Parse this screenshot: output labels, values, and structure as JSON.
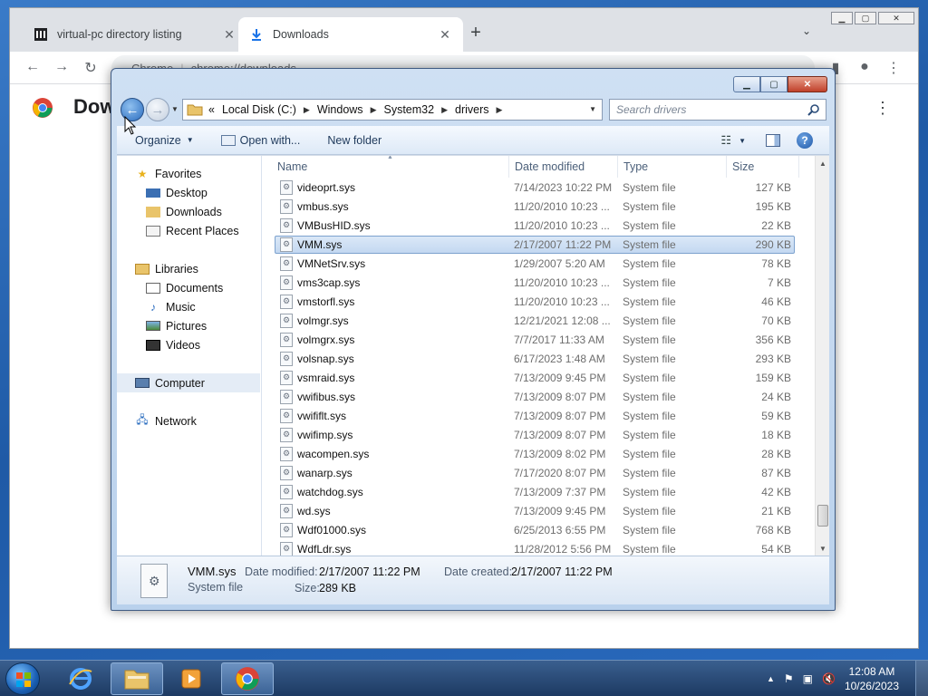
{
  "chrome": {
    "tabs": [
      {
        "title": "virtual-pc directory listing",
        "close": "✕"
      },
      {
        "title": "Downloads",
        "close": "✕"
      }
    ],
    "new_tab": "+",
    "tab_search": "⌄",
    "omnibox": {
      "site_label": "Chrome",
      "url": "chrome://downloads"
    },
    "page_title": "Dow",
    "menu_glyph": "⋮"
  },
  "explorer": {
    "caption": {
      "minimize": "▁",
      "maximize": "▢",
      "close": "✕"
    },
    "breadcrumb": {
      "prefix": "«",
      "items": [
        "Local Disk (C:)",
        "Windows",
        "System32",
        "drivers"
      ]
    },
    "search_placeholder": "Search drivers",
    "commands": {
      "organize": "Organize",
      "open_with": "Open with...",
      "new_folder": "New folder"
    },
    "nav": {
      "favorites": "Favorites",
      "favorites_items": [
        "Desktop",
        "Downloads",
        "Recent Places"
      ],
      "libraries": "Libraries",
      "libraries_items": [
        "Documents",
        "Music",
        "Pictures",
        "Videos"
      ],
      "computer": "Computer",
      "network": "Network"
    },
    "columns": {
      "name": "Name",
      "date": "Date modified",
      "type": "Type",
      "size": "Size"
    },
    "files": [
      {
        "name": "videoprt.sys",
        "date": "7/14/2023 10:22 PM",
        "type": "System file",
        "size": "127 KB"
      },
      {
        "name": "vmbus.sys",
        "date": "11/20/2010 10:23 ...",
        "type": "System file",
        "size": "195 KB"
      },
      {
        "name": "VMBusHID.sys",
        "date": "11/20/2010 10:23 ...",
        "type": "System file",
        "size": "22 KB"
      },
      {
        "name": "VMM.sys",
        "date": "2/17/2007 11:22 PM",
        "type": "System file",
        "size": "290 KB"
      },
      {
        "name": "VMNetSrv.sys",
        "date": "1/29/2007 5:20 AM",
        "type": "System file",
        "size": "78 KB"
      },
      {
        "name": "vms3cap.sys",
        "date": "11/20/2010 10:23 ...",
        "type": "System file",
        "size": "7 KB"
      },
      {
        "name": "vmstorfl.sys",
        "date": "11/20/2010 10:23 ...",
        "type": "System file",
        "size": "46 KB"
      },
      {
        "name": "volmgr.sys",
        "date": "12/21/2021 12:08 ...",
        "type": "System file",
        "size": "70 KB"
      },
      {
        "name": "volmgrx.sys",
        "date": "7/7/2017 11:33 AM",
        "type": "System file",
        "size": "356 KB"
      },
      {
        "name": "volsnap.sys",
        "date": "6/17/2023 1:48 AM",
        "type": "System file",
        "size": "293 KB"
      },
      {
        "name": "vsmraid.sys",
        "date": "7/13/2009 9:45 PM",
        "type": "System file",
        "size": "159 KB"
      },
      {
        "name": "vwifibus.sys",
        "date": "7/13/2009 8:07 PM",
        "type": "System file",
        "size": "24 KB"
      },
      {
        "name": "vwififlt.sys",
        "date": "7/13/2009 8:07 PM",
        "type": "System file",
        "size": "59 KB"
      },
      {
        "name": "vwifimp.sys",
        "date": "7/13/2009 8:07 PM",
        "type": "System file",
        "size": "18 KB"
      },
      {
        "name": "wacompen.sys",
        "date": "7/13/2009 8:02 PM",
        "type": "System file",
        "size": "28 KB"
      },
      {
        "name": "wanarp.sys",
        "date": "7/17/2020 8:07 PM",
        "type": "System file",
        "size": "87 KB"
      },
      {
        "name": "watchdog.sys",
        "date": "7/13/2009 7:37 PM",
        "type": "System file",
        "size": "42 KB"
      },
      {
        "name": "wd.sys",
        "date": "7/13/2009 9:45 PM",
        "type": "System file",
        "size": "21 KB"
      },
      {
        "name": "Wdf01000.sys",
        "date": "6/25/2013 6:55 PM",
        "type": "System file",
        "size": "768 KB"
      },
      {
        "name": "WdfLdr.sys",
        "date": "11/28/2012 5:56 PM",
        "type": "System file",
        "size": "54 KB"
      }
    ],
    "selected_index": 3,
    "details": {
      "name": "VMM.sys",
      "type": "System file",
      "date_modified_label": "Date modified:",
      "date_modified": "2/17/2007 11:22 PM",
      "date_created_label": "Date created:",
      "date_created": "2/17/2007 11:22 PM",
      "size_label": "Size:",
      "size": "289 KB"
    }
  },
  "taskbar": {
    "time": "12:08 AM",
    "date": "10/26/2023",
    "tray_arrow": "▲"
  }
}
